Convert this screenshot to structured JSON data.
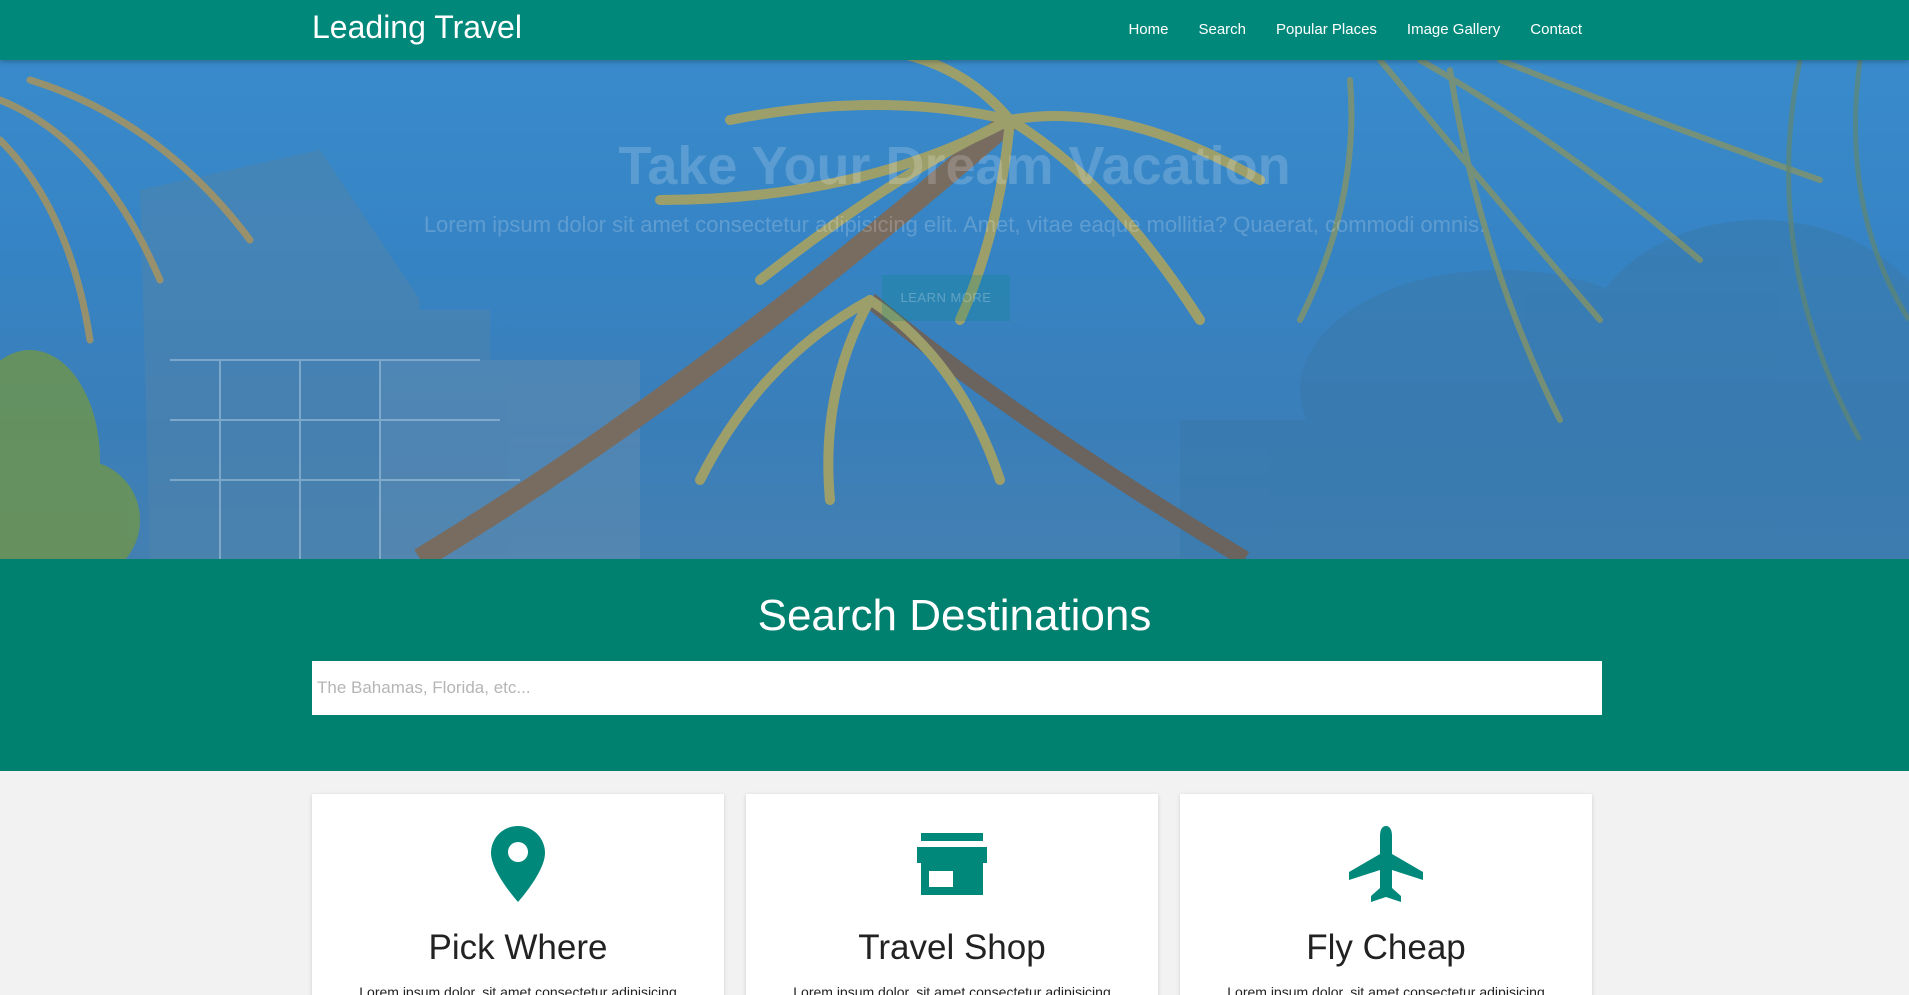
{
  "navbar": {
    "brand": "Leading Travel",
    "links": [
      "Home",
      "Search",
      "Popular Places",
      "Image Gallery",
      "Contact"
    ]
  },
  "hero": {
    "title": "Take Your Dream Vacation",
    "text": "Lorem ipsum dolor sit amet consectetur adipisicing elit. Amet, vitae eaque mollitia? Quaerat, commodi omnis.",
    "button_label": "LEARN MORE"
  },
  "search": {
    "heading": "Search Destinations",
    "placeholder": "The Bahamas, Florida, etc...",
    "value": ""
  },
  "cards": [
    {
      "icon": "map-marker-icon",
      "title": "Pick Where",
      "text": "Lorem ipsum dolor, sit amet consectetur adipisicing"
    },
    {
      "icon": "store-icon",
      "title": "Travel Shop",
      "text": "Lorem ipsum dolor, sit amet consectetur adipisicing"
    },
    {
      "icon": "airplane-icon",
      "title": "Fly Cheap",
      "text": "Lorem ipsum dolor, sit amet consectetur adipisicing"
    }
  ],
  "colors": {
    "primary": "#00897b",
    "search_bg": "#00806f",
    "page_bg": "#f2f2f2"
  }
}
